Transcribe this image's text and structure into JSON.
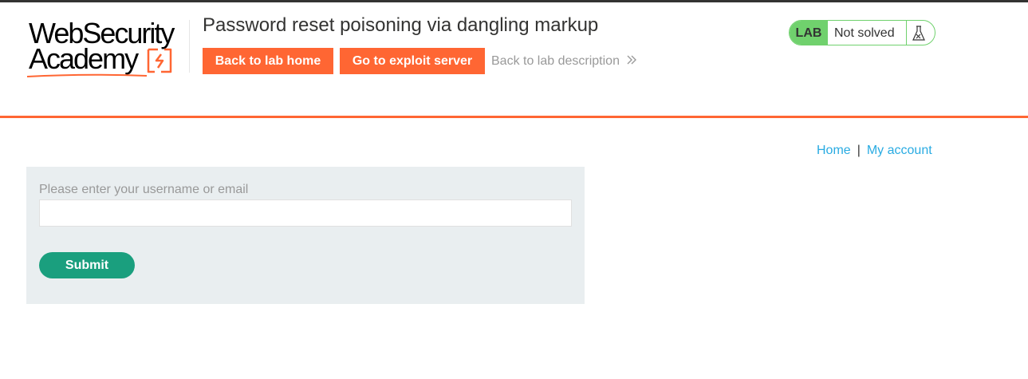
{
  "header": {
    "logo": {
      "line1": "WebSecurity",
      "line2": "Academy",
      "brand_color": "#ff6633"
    },
    "lab_title": "Password reset poisoning via dangling markup",
    "buttons": {
      "back_to_lab_home": "Back to lab home",
      "go_to_exploit_server": "Go to exploit server"
    },
    "back_to_description": "Back to lab description",
    "status": {
      "tag": "LAB",
      "text": "Not solved",
      "icon": "flask-icon",
      "color": "#70d16d"
    }
  },
  "nav": {
    "home": "Home",
    "separator": "|",
    "my_account": "My account",
    "link_color": "#29abe2"
  },
  "form": {
    "label": "Please enter your username or email",
    "input_value": "",
    "submit_label": "Submit",
    "submit_color": "#1a9f7e"
  },
  "accent_color": "#ff6633"
}
